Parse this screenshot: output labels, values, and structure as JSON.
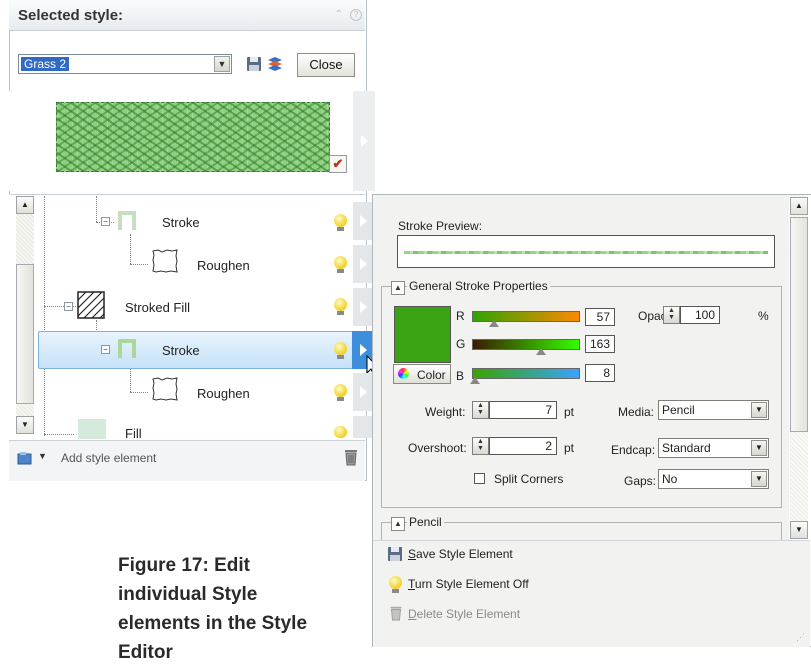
{
  "left_panel": {
    "title": "Selected style:",
    "style_select": {
      "value": "Grass 2"
    },
    "close_label": "Close"
  },
  "tree": {
    "rows": [
      {
        "label": "Stroke"
      },
      {
        "label": "Roughen"
      },
      {
        "label": "Stroked Fill"
      },
      {
        "label": "Stroke"
      },
      {
        "label": "Roughen"
      },
      {
        "label": "Fill"
      }
    ]
  },
  "footer": {
    "add_label": "Add style element"
  },
  "caption": "Figure 17: Edit individual Style elements in the Style Editor",
  "editor": {
    "stroke_preview_label": "Stroke Preview:",
    "general_group_title": "General Stroke Properties",
    "pencil_group_title": "Pencil",
    "color_label": "Color",
    "channels": [
      {
        "label": "R",
        "value": "57"
      },
      {
        "label": "G",
        "value": "163"
      },
      {
        "label": "B",
        "value": "8"
      }
    ],
    "opacity_label": "Opacity:",
    "opacity_value": "100",
    "opacity_unit": "%",
    "weight_label": "Weight:",
    "weight_value": "7",
    "weight_unit": "pt",
    "overshoot_label": "Overshoot:",
    "overshoot_value": "2",
    "overshoot_unit": "pt",
    "split_corners_label": "Split Corners",
    "media_label": "Media:",
    "media_value": "Pencil",
    "endcap_label": "Endcap:",
    "endcap_value": "Standard",
    "gaps_label": "Gaps:",
    "gaps_value": "No",
    "current_color": "#39a314"
  },
  "menu": {
    "save_first": "S",
    "save_rest": "ave Style Element",
    "turn_first": "T",
    "turn_rest": "urn Style Element Off",
    "delete_first": "D",
    "delete_rest": "elete Style Element"
  },
  "colors": {
    "selection": "#c6e2f8",
    "accent_blue": "#3d8fdb",
    "swatch_green": "#39a314"
  }
}
